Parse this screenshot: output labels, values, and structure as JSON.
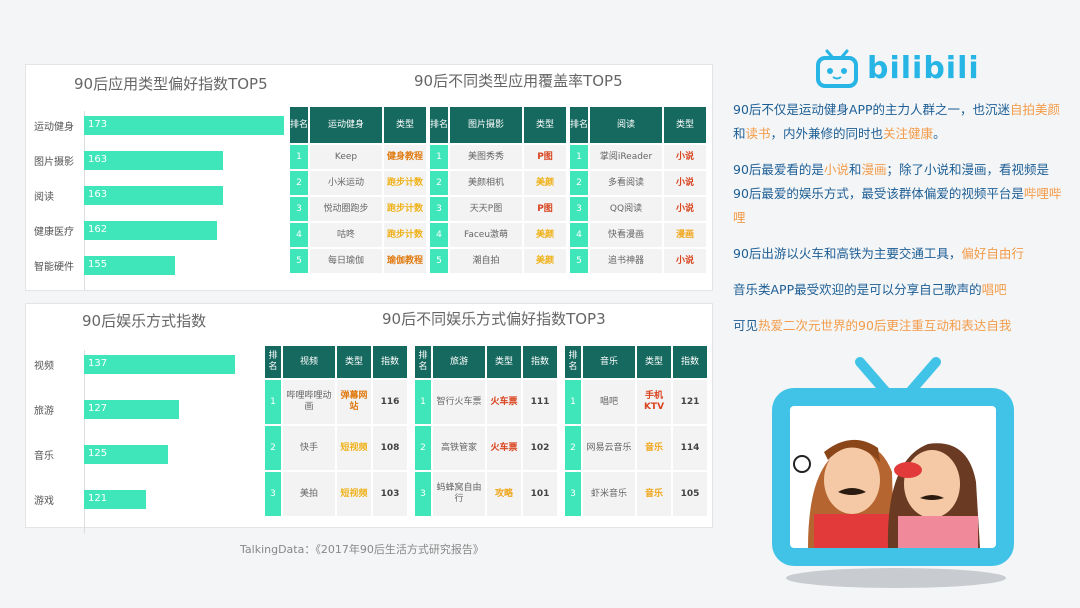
{
  "source": "TalkingData：《2017年90后生活方式研究报告》",
  "colors": {
    "bar": "#3fe6b9",
    "header": "#16695f",
    "text": "#1c5e95",
    "highlight": "#f39c4a",
    "type_red": "#d9441f",
    "type_orange": "#e07b12",
    "type_yellow": "#efb21b",
    "type_gold": "#f0a61a",
    "logo": "#26b5e5"
  },
  "logo": {
    "text": "bilibili"
  },
  "titles": {
    "top_left": "90后应用类型偏好指数TOP5",
    "top_right": "90后不同类型应用覆盖率TOP5",
    "bot_left": "90后娱乐方式指数",
    "bot_right": "90后不同娱乐方式偏好指数TOP3"
  },
  "chart_data": [
    {
      "type": "bar",
      "title": "90后应用类型偏好指数TOP5",
      "categories": [
        "运动健身",
        "图片摄影",
        "阅读",
        "健康医疗",
        "智能硬件"
      ],
      "values": [
        173,
        163,
        163,
        162,
        155
      ],
      "ylim": [
        140,
        175
      ]
    },
    {
      "type": "bar",
      "title": "90后娱乐方式指数",
      "categories": [
        "视频",
        "旅游",
        "音乐",
        "游戏"
      ],
      "values": [
        137,
        127,
        125,
        121
      ],
      "ylim": [
        110,
        140
      ]
    },
    {
      "type": "table",
      "title": "90后不同类型应用覆盖率TOP5",
      "tables": [
        {
          "headers": [
            "排名",
            "运动健身",
            "类型"
          ],
          "rows": [
            [
              "1",
              "Keep",
              "健身教程"
            ],
            [
              "2",
              "小米运动",
              "跑步计数"
            ],
            [
              "3",
              "悦动圈跑步",
              "跑步计数"
            ],
            [
              "4",
              "咕咚",
              "跑步计数"
            ],
            [
              "5",
              "每日瑜伽",
              "瑜伽教程"
            ]
          ]
        },
        {
          "headers": [
            "排名",
            "图片摄影",
            "类型"
          ],
          "rows": [
            [
              "1",
              "美图秀秀",
              "P图"
            ],
            [
              "2",
              "美颜相机",
              "美颜"
            ],
            [
              "3",
              "天天P图",
              "P图"
            ],
            [
              "4",
              "Faceu激萌",
              "美颜"
            ],
            [
              "5",
              "潮自拍",
              "美颜"
            ]
          ]
        },
        {
          "headers": [
            "排名",
            "阅读",
            "类型"
          ],
          "rows": [
            [
              "1",
              "掌阅iReader",
              "小说"
            ],
            [
              "2",
              "多看阅读",
              "小说"
            ],
            [
              "3",
              "QQ阅读",
              "小说"
            ],
            [
              "4",
              "快看漫画",
              "漫画"
            ],
            [
              "5",
              "追书神器",
              "小说"
            ]
          ]
        }
      ]
    },
    {
      "type": "table",
      "title": "90后不同娱乐方式偏好指数TOP3",
      "tables": [
        {
          "headers": [
            "排名",
            "视频",
            "类型",
            "指数"
          ],
          "rows": [
            [
              "1",
              "哔哩哔哩动画",
              "弹幕网站",
              "116"
            ],
            [
              "2",
              "快手",
              "短视频",
              "108"
            ],
            [
              "3",
              "美拍",
              "短视频",
              "103"
            ]
          ]
        },
        {
          "headers": [
            "排名",
            "旅游",
            "类型",
            "指数"
          ],
          "rows": [
            [
              "1",
              "智行火车票",
              "火车票",
              "111"
            ],
            [
              "2",
              "高铁管家",
              "火车票",
              "102"
            ],
            [
              "3",
              "蚂蜂窝自由行",
              "攻略",
              "101"
            ]
          ]
        },
        {
          "headers": [
            "排名",
            "音乐",
            "类型",
            "指数"
          ],
          "rows": [
            [
              "1",
              "唱吧",
              "手机KTV",
              "121"
            ],
            [
              "2",
              "网易云音乐",
              "音乐",
              "114"
            ],
            [
              "3",
              "虾米音乐",
              "音乐",
              "105"
            ]
          ]
        }
      ]
    }
  ],
  "notes": [
    [
      {
        "t": "90后不仅是运动健身APP的主力人群之一，也沉迷"
      },
      {
        "t": "自拍美颜",
        "h": true
      },
      {
        "t": "和"
      },
      {
        "t": "读书",
        "h": true
      },
      {
        "t": "，内外兼修的同时也"
      },
      {
        "t": "关注健康",
        "h": true
      },
      {
        "t": "。"
      }
    ],
    [
      {
        "t": "90后最爱看的是"
      },
      {
        "t": "小说",
        "h": true
      },
      {
        "t": "和"
      },
      {
        "t": "漫画",
        "h": true
      },
      {
        "t": "；除了小说和漫画，看视频是90后最爱的娱乐方式，最受该群体偏爱的视频平台是"
      },
      {
        "t": "哔哩哔哩",
        "h": true
      }
    ],
    [
      {
        "t": "90后出游以火车和高铁为主要交通工具，"
      },
      {
        "t": "偏好自由行",
        "h": true
      }
    ],
    [
      {
        "t": "音乐类APP最受欢迎的是可以分享自己歌声的"
      },
      {
        "t": "唱吧",
        "h": true
      }
    ],
    [
      {
        "t": "可见"
      },
      {
        "t": "热爱二次元世界的90后更注重互动和表达自我",
        "h": true
      }
    ]
  ]
}
